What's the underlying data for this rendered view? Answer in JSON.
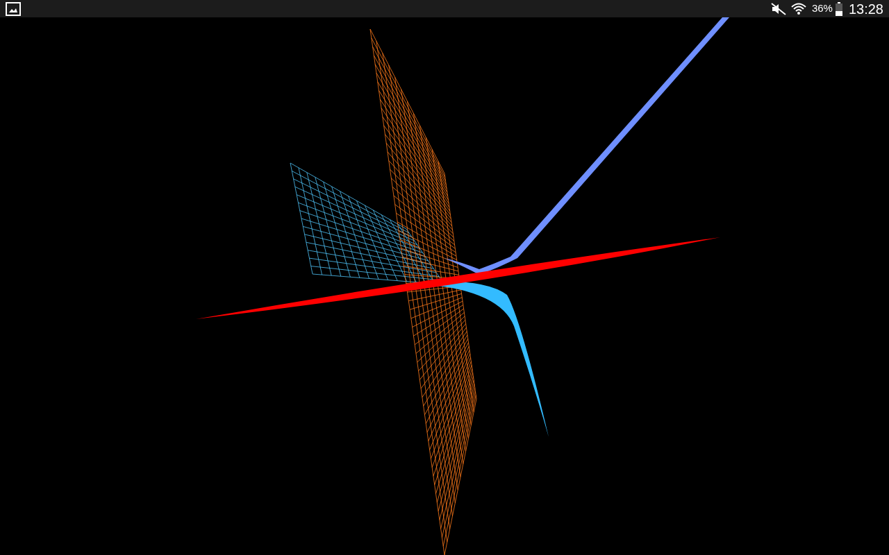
{
  "status_bar": {
    "battery": "36%",
    "time": "13:28"
  }
}
